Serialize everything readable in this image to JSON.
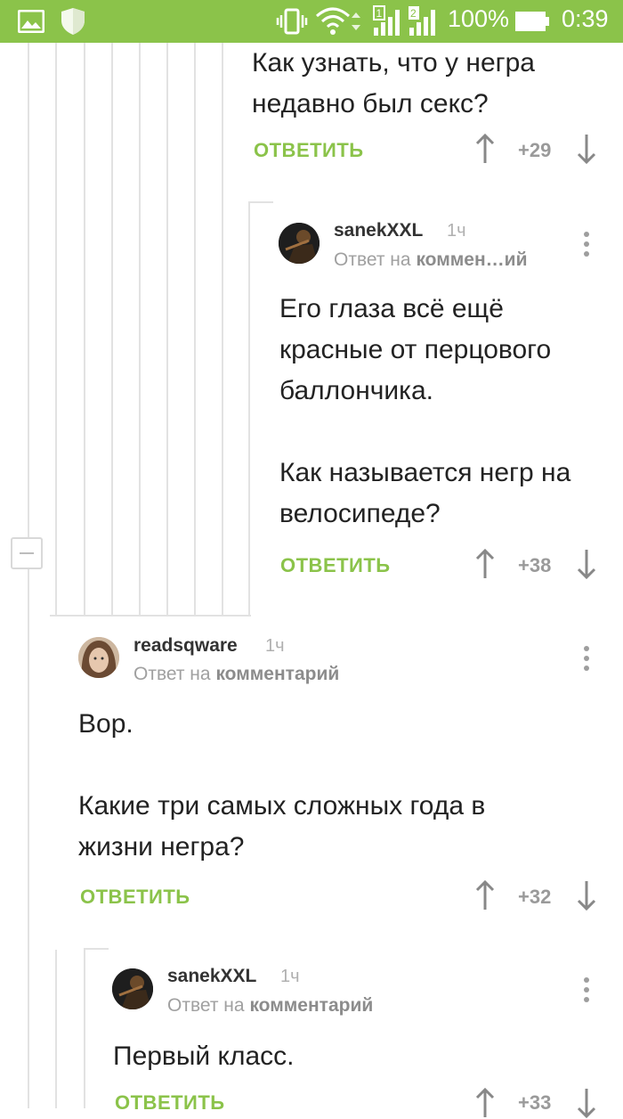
{
  "status_bar": {
    "battery": "100%",
    "time": "0:39",
    "sim1": "1",
    "sim2": "2"
  },
  "comments": [
    {
      "text": "Как узнать, что у негра\nнедавно был секс?",
      "reply_label": "ОТВЕТИТЬ",
      "rating": "+29"
    },
    {
      "author": "sanekXXL",
      "time": "1ч",
      "reply_to_prefix": "Ответ на",
      "reply_to": "коммен…ий",
      "text": "Его глаза всё ещё\nкрасные от перцового\nбаллончика.\n\nКак называется негр на\nвелосипеде?",
      "reply_label": "ОТВЕТИТЬ",
      "rating": "+38"
    },
    {
      "author": "readsqware",
      "time": "1ч",
      "reply_to_prefix": "Ответ на",
      "reply_to": "комментарий",
      "text": "Вор.\n\nКакие три самых сложных года в\nжизни негра?",
      "reply_label": "ОТВЕТИТЬ",
      "rating": "+32"
    },
    {
      "author": "sanekXXL",
      "time": "1ч",
      "reply_to_prefix": "Ответ на",
      "reply_to": "комментарий",
      "text": "Первый класс.",
      "reply_label": "ОТВЕТИТЬ",
      "rating": "+33"
    }
  ],
  "colors": {
    "accent": "#8bc34a",
    "thread_line": "#e2e2e2",
    "rating": "#9a9a9a"
  }
}
